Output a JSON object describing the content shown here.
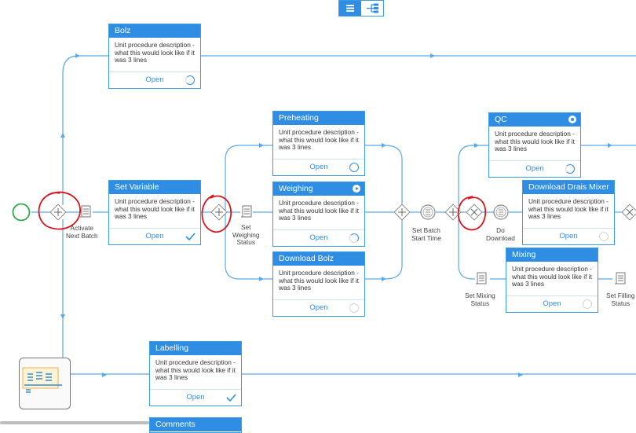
{
  "toolbar": {
    "list_view_icon": "list-view-icon",
    "tree_view_icon": "tree-view-icon"
  },
  "colors": {
    "accent": "#2f8de4",
    "line": "#5aa9e6",
    "start_event": "#2eaa48",
    "annotation": "#d9141c"
  },
  "cards": {
    "bolz": {
      "title": "Bolz",
      "desc": "Unit procedure description - what this would look like if it was 3 lines",
      "action": "Open",
      "status": "in-progress"
    },
    "set_variable": {
      "title": "Set Variable",
      "desc": "Unit procedure description - what this would look like if it was 3 lines",
      "action": "Open",
      "status": "completed"
    },
    "preheating": {
      "title": "Preheating",
      "desc": "Unit procedure description - what this would look like if it was 3 lines",
      "action": "Open",
      "status": "in-progress"
    },
    "weighing": {
      "title": "Weighing",
      "desc": "Unit procedure description - what this would look like if it was 3 lines",
      "action": "Open",
      "status": "in-progress"
    },
    "download_bolz": {
      "title": "Download Bolz",
      "desc": "Unit procedure description - what this would look like if it was 3 lines",
      "action": "Open",
      "status": "not-started"
    },
    "qc": {
      "title": "QC",
      "desc": "Unit procedure description - what this would look like if it was 3 lines",
      "action": "Open",
      "status": "in-progress"
    },
    "download_drais": {
      "title": "Download Drais Mixer",
      "desc": "Unit procedure description - what this would look like if it was 3 lines",
      "action": "Open",
      "status": "not-started"
    },
    "mixing": {
      "title": "Mixing",
      "desc": "Unit procedure description - what this would look like if it was 3 lines",
      "action": "Open",
      "status": "not-started"
    },
    "labelling": {
      "title": "Labelling",
      "desc": "Unit procedure description - what this would look like if it was 3 lines",
      "action": "Open",
      "status": "completed"
    },
    "comments": {
      "title": "Comments"
    }
  },
  "tasks": {
    "activate_next_batch": "Activate\nNext Batch",
    "set_weighing_status": "Set\nWeighing\nStatus",
    "set_batch_start_time": "Set Batch\nStart Time",
    "do_download": "Do\nDownload",
    "set_mixing_status": "Set Mixing\nStatus",
    "set_filling_status": "Set Filling\nStatus"
  }
}
